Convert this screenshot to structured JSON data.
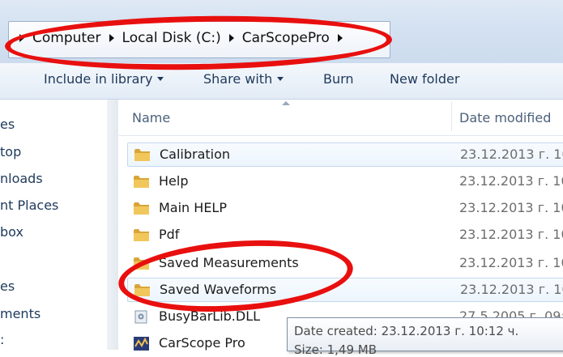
{
  "breadcrumb": {
    "items": [
      "Computer",
      "Local Disk (C:)",
      "CarScopePro"
    ]
  },
  "toolbar": {
    "include_label": "Include in library",
    "share_label": "Share with",
    "burn_label": "Burn",
    "new_folder_label": "New folder"
  },
  "nav": {
    "items": [
      "es",
      "top",
      "nloads",
      "nt Places",
      "box",
      "es",
      "ments",
      ":"
    ]
  },
  "columns": {
    "name": "Name",
    "date": "Date modified"
  },
  "files": [
    {
      "name": "Calibration",
      "date": "23.12.2013 г. 10",
      "icon": "folder-icon"
    },
    {
      "name": "Help",
      "date": "23.12.2013 г. 10",
      "icon": "folder-icon"
    },
    {
      "name": "Main HELP",
      "date": "23.12.2013 г. 10",
      "icon": "folder-icon"
    },
    {
      "name": "Pdf",
      "date": "23.12.2013 г. 10",
      "icon": "folder-icon"
    },
    {
      "name": "Saved Measurements",
      "date": "23.12.2013 г. 10",
      "icon": "folder-icon"
    },
    {
      "name": "Saved Waveforms",
      "date": "23.12.2013 г. 10",
      "icon": "folder-icon"
    },
    {
      "name": "BusyBarLib.DLL",
      "date": "27.5.2005 г. 09:5",
      "icon": "dll-icon"
    },
    {
      "name": "CarScope Pro",
      "date": "",
      "icon": "app-icon"
    }
  ],
  "tooltip": {
    "created": "Date created: 23.12.2013 г. 10:12 ч.",
    "size": "Size: 1,49 MB"
  },
  "colors": {
    "annotation": "#e8100f",
    "folder": "#e9b949",
    "hover_border": "#c3d7ee"
  }
}
